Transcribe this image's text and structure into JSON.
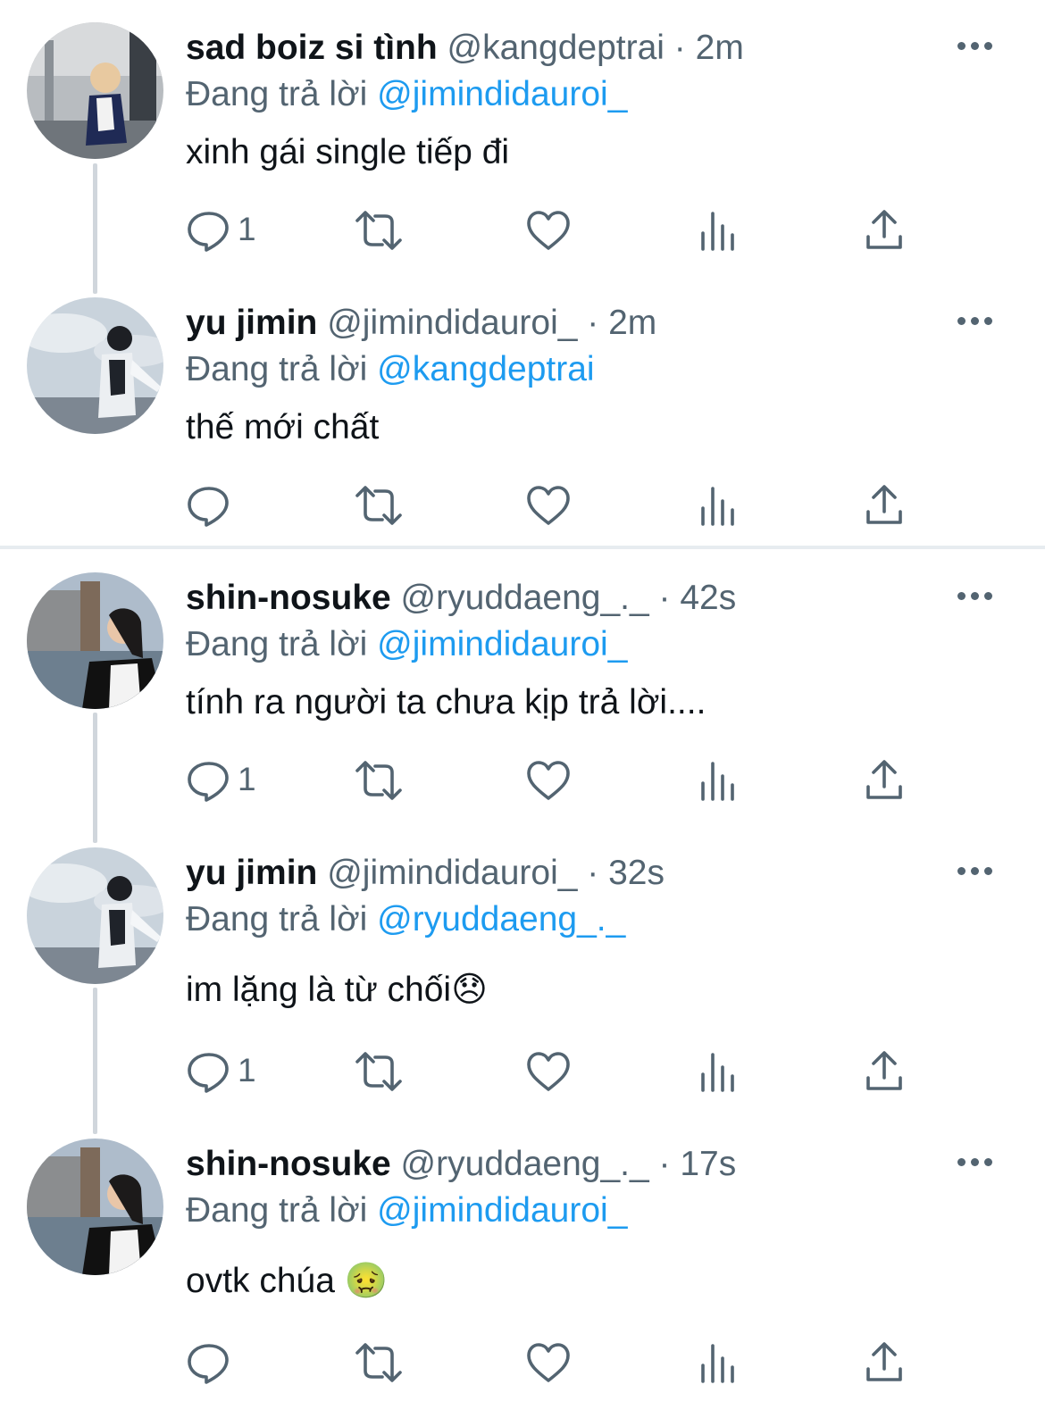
{
  "tweets": [
    {
      "name": "sad boiz si tình",
      "handle": "@kangdeptrai",
      "time": "2m",
      "reply_prefix": "Đang trả lời",
      "reply_mention": "@jimindidauroi_",
      "text": "xinh gái single tiếp đi",
      "reply_count": "1"
    },
    {
      "name": "yu jimin",
      "handle": "@jimindidauroi_",
      "time": "2m",
      "reply_prefix": "Đang trả lời",
      "reply_mention": "@kangdeptrai",
      "text": "thế mới chất",
      "reply_count": ""
    },
    {
      "name": "shin-nosuke",
      "handle": "@ryuddaeng_._",
      "time": "42s",
      "reply_prefix": "Đang trả lời",
      "reply_mention": "@jimindidauroi_",
      "text": "tính ra người ta chưa kịp trả lời....",
      "reply_count": "1"
    },
    {
      "name": "yu jimin",
      "handle": "@jimindidauroi_",
      "time": "32s",
      "reply_prefix": "Đang trả lời",
      "reply_mention": "@ryuddaeng_._",
      "text": "im lặng là từ chối",
      "emoji": "😞",
      "reply_count": "1"
    },
    {
      "name": "shin-nosuke",
      "handle": "@ryuddaeng_._",
      "time": "17s",
      "reply_prefix": "Đang trả lời",
      "reply_mention": "@jimindidauroi_",
      "text": "ovtk chúa",
      "emoji": "🤢",
      "reply_count": ""
    }
  ],
  "separator": "·",
  "colors": {
    "accent": "#1d9bf0",
    "secondary_text": "#536471",
    "primary_text": "#0f1419",
    "thread_line": "#d0d6dc"
  },
  "icons": [
    "reply-icon",
    "retweet-icon",
    "like-icon",
    "views-icon",
    "share-icon",
    "more-icon"
  ]
}
